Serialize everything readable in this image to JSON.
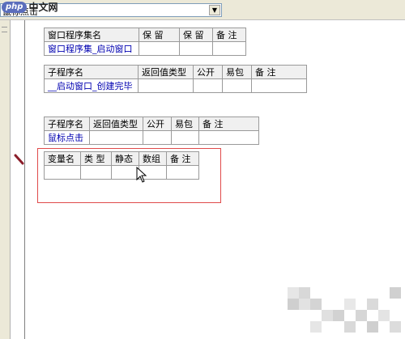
{
  "header": {
    "combo_value": "鼠标点击",
    "logo_badge": "php",
    "logo_text": "中文网"
  },
  "table1": {
    "headers": [
      "窗口程序集名",
      "保 留",
      "保 留",
      "备 注"
    ],
    "row": [
      "窗口程序集_启动窗口",
      "",
      "",
      ""
    ]
  },
  "table2": {
    "headers": [
      "子程序名",
      "返回值类型",
      "公开",
      "易包",
      "备 注"
    ],
    "row": [
      "__启动窗口_创建完毕",
      "",
      "",
      "",
      ""
    ]
  },
  "table3": {
    "headers": [
      "子程序名",
      "返回值类型",
      "公开",
      "易包",
      "备 注"
    ],
    "row": [
      "鼠标点击",
      "",
      "",
      "",
      ""
    ]
  },
  "table4": {
    "headers": [
      "变量名",
      "类 型",
      "静态",
      "数组",
      "备 注"
    ],
    "row": [
      "",
      "",
      "",
      "",
      ""
    ]
  },
  "colors": {
    "highlight_box": "#e04a4a",
    "subroutine_text": "#0000b0",
    "logo": "#5b6ebc"
  },
  "icons": [
    "chevron-down-icon",
    "breakpoint-marker-icon",
    "mouse-cursor-icon"
  ]
}
